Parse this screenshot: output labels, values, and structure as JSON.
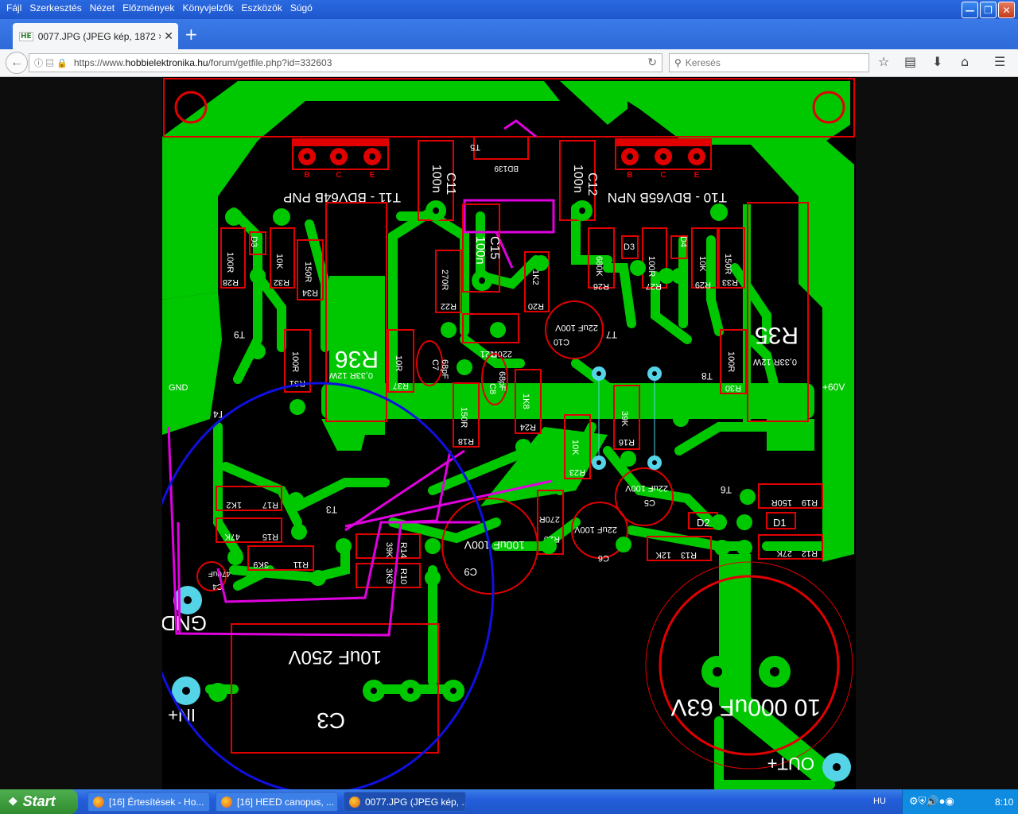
{
  "menu": [
    "Fájl",
    "Szerkesztés",
    "Nézet",
    "Előzmények",
    "Könyvjelzők",
    "Eszközök",
    "Súgó"
  ],
  "tab": {
    "favicon": "HE",
    "title": "0077.JPG (JPEG kép, 1872 × ...",
    "close": "✕"
  },
  "newtab": "+",
  "nav": {
    "url_prefix": "https://www.",
    "url_domain": "hobbielektronika.hu",
    "url_path": "/forum/getfile.php?id=332603",
    "search_placeholder": "Keresés"
  },
  "pcb": {
    "transistors": {
      "t11": "T11 - BDV64B PNP",
      "t10": "T10 - BDV65B NPN",
      "t5": "T5",
      "bd139": "BD139"
    },
    "caps": {
      "c11": "C11",
      "c11v": "100n",
      "c12": "C12",
      "c12v": "100n",
      "c15": "C15",
      "c15v": "100n",
      "c10": "C10",
      "c10v": "22uF 100V",
      "c7": "C7",
      "c7v": "68pF",
      "c8": "C8",
      "c8v": "68pF",
      "c9": "C9",
      "c9v": "100uF 100V",
      "c6": "C6",
      "c6v": "22uF 100V",
      "c5": "C5",
      "c5v": "22uF 100V",
      "c4": "C4",
      "c4v": "470uF",
      "c3": "C3",
      "c3v": "10uF 250V",
      "cbig": "10 000uF 63V"
    },
    "resistors": [
      {
        "ref": "R28",
        "val": "100R"
      },
      {
        "ref": "R32",
        "val": "10K"
      },
      {
        "ref": "R34",
        "val": "150R"
      },
      {
        "ref": "R22",
        "val": "270R"
      },
      {
        "ref": "R20",
        "val": "1K2"
      },
      {
        "ref": "R26",
        "val": "680K"
      },
      {
        "ref": "R27",
        "val": "100R"
      },
      {
        "ref": "R29",
        "val": "10K"
      },
      {
        "ref": "R33",
        "val": "150R"
      },
      {
        "ref": "R31",
        "val": "100R"
      },
      {
        "ref": "R37",
        "val": "10R"
      },
      {
        "ref": "R21",
        "val": "220R"
      },
      {
        "ref": "R18",
        "val": "150R"
      },
      {
        "ref": "R24",
        "val": "1K8"
      },
      {
        "ref": "R16",
        "val": "39K"
      },
      {
        "ref": "R23",
        "val": "10K"
      },
      {
        "ref": "R30",
        "val": "100R"
      },
      {
        "ref": "R17",
        "val": "1K2"
      },
      {
        "ref": "R15",
        "val": "47K"
      },
      {
        "ref": "R11",
        "val": "3K9"
      },
      {
        "ref": "R14",
        "val": "39K"
      },
      {
        "ref": "R10",
        "val": "3K9"
      },
      {
        "ref": "R25",
        "val": "270R"
      },
      {
        "ref": "R13",
        "val": "12K"
      },
      {
        "ref": "R19",
        "val": "150R"
      },
      {
        "ref": "R12",
        "val": "27K"
      }
    ],
    "r36": "R36",
    "r36v": "0,33R 12W",
    "r35": "R35",
    "r35v": "0,33R 12W",
    "diodes": {
      "d3a": "D3",
      "d3b": "D3",
      "d4": "D4",
      "d2": "D2",
      "d1": "D1"
    },
    "other": {
      "t9": "T9",
      "t4": "T4",
      "t3": "T3",
      "t7": "T7",
      "t8": "T8",
      "t6": "T6"
    },
    "terminals": {
      "gnd_left": "GND",
      "v60": "+60V",
      "gnd_bottom": "GND",
      "in": "IN+",
      "out": "OUT+",
      "pin_e": "E",
      "pin_b": "B",
      "pin_c": "C"
    }
  },
  "taskbar": {
    "start": "Start",
    "buttons": [
      "[16] Értesítések - Ho...",
      "[16] HEED canopus, ...",
      "0077.JPG (JPEG kép, ..."
    ],
    "lang": "HU",
    "clock": "8:10"
  },
  "colors": {
    "board_green": "#00c800",
    "silk_red": "#e00000",
    "magenta": "#e000e0",
    "cyan": "#55d4e8",
    "blue_circle": "#1010e0"
  }
}
